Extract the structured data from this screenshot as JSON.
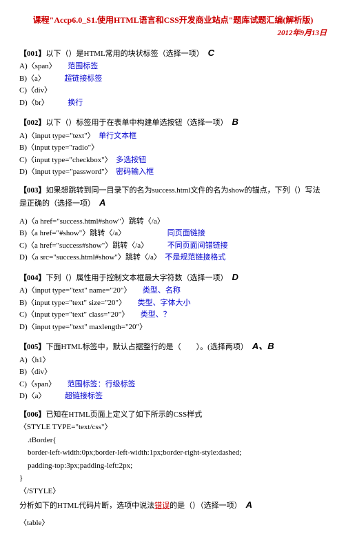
{
  "title": "课程\"Accp6.0_S1.使用HTML语言和CSS开发商业站点\"题库试题汇编(解析版)",
  "date": "2012年9月13日",
  "q001": {
    "header_bold": "【001】",
    "header_text": "以下（）是HTML常用的块状标签（选择一项）",
    "answer": "C",
    "a_code": "A)〈span〉",
    "a_note": "范围标签",
    "b_code": "B)〈a〉",
    "b_note": "超链接标签",
    "c_code": "C)〈div〉",
    "d_code": "D)〈br〉",
    "d_note": "换行"
  },
  "q002": {
    "header_bold": "【002】",
    "header_text": "以下（）标签用于在表单中构建单选按钮（选择一项）",
    "answer": "B",
    "a": "A)〈input type=\"text\"〉",
    "a_note": "单行文本框",
    "b": "B)〈input type=\"radio\"〉",
    "c": "C)〈input type=\"checkbox\"〉",
    "c_note": "多选按钮",
    "d": "D)〈input type=\"password\"〉",
    "d_note": "密码输入框"
  },
  "q003": {
    "header_bold": "【003】",
    "header_text1": "如果想跳转到同一目录下的名为success.html文件的名为show的锚点，下列（）写法是正确的（选择一项）",
    "answer": "A",
    "a": "A)〈a href=\"success.html#show\"〉跳转〈/a〉",
    "b": "B)〈a href=\"#show\"〉跳转〈/a〉",
    "b_note": "同页面链接",
    "c": "C)〈a href=\"success#show\"〉跳转〈/a〉",
    "c_note": "不同页面间错链接",
    "d": "D)〈a src=\"success.html#show\"〉跳转〈/a〉",
    "d_note": "不是规范链接格式"
  },
  "q004": {
    "header_bold": "【004】",
    "header_text": "下列（）属性用于控制文本框最大字符数（选择一项）",
    "answer": "D",
    "a": "A)〈input type=\"text\" name=\"20\"〉",
    "a_note": "类型、名称",
    "b": "B)〈input type=\"text\" size=\"20\"〉",
    "b_note": "类型、字体大小",
    "c": "C)〈input type=\"text\" class=\"20\"〉",
    "c_note": "类型、？",
    "d": "D)〈input type=\"text\" maxlength=\"20\"〉"
  },
  "q005": {
    "header_bold": "【005】",
    "header_text": "下面HTML标签中，默认占据整行的是（　　）。(选择两项）",
    "answer": "A、B",
    "a": "A)〈h1〉",
    "b": "B)〈div〉",
    "c": "C)〈span〉",
    "c_note": "范围标签：行级标签",
    "d": "D)〈a〉",
    "d_note": "超链接标签"
  },
  "q006": {
    "header_bold": "【006】",
    "header_text": "已知在HTML页面上定义了如下所示的CSS样式",
    "code1": "〈STYLE TYPE=\"text/css\"〉",
    "code2": ".tBorder{",
    "code3": "border-left-width:0px;border-left-width:1px;border-right-style:dashed;",
    "code4": "padding-top:3px;padding-left:2px;",
    "code5": "}",
    "code6": "〈/STYLE〉",
    "footer1": "分析如下的HTML代码片断，选项中说法",
    "footer_err": "错误",
    "footer2": "的是（）（选择一项）",
    "answer": "A",
    "table": "〈table〉"
  }
}
